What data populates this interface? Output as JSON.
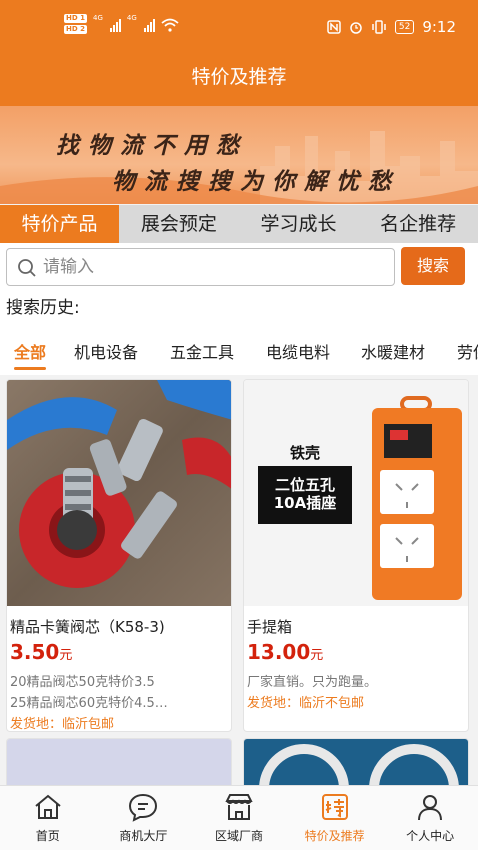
{
  "status_bar": {
    "time": "9:12",
    "hd1": "HD 1",
    "hd2": "HD 2",
    "net1": "4G",
    "net2": "4G",
    "battery": "52"
  },
  "header": {
    "title": "特价及推荐"
  },
  "banner": {
    "line1": "找物流不用愁",
    "line2": "物流搜搜为你解忧愁"
  },
  "tabs": [
    {
      "label": "特价产品",
      "active": true
    },
    {
      "label": "展会预定"
    },
    {
      "label": "学习成长"
    },
    {
      "label": "名企推荐"
    }
  ],
  "search": {
    "placeholder": "请输入",
    "button_label": "搜索"
  },
  "history_label": "搜索历史:",
  "categories": [
    {
      "label": "全部",
      "active": true
    },
    {
      "label": "机电设备"
    },
    {
      "label": "五金工具"
    },
    {
      "label": "电缆电料"
    },
    {
      "label": "水暖建材"
    },
    {
      "label": "劳保"
    }
  ],
  "products": [
    {
      "title": "精品卡簧阀芯（K58-3)",
      "price": "3.50",
      "unit": "元",
      "desc1": "20精品阀芯50克特价3.5",
      "desc2": "25精品阀芯60克特价4.5…",
      "ship": "发货地：临沂包邮"
    },
    {
      "title": "手提箱",
      "price": "13.00",
      "unit": "元",
      "desc1": "厂家直销。只为跑量。",
      "ship": "发货地：临沂不包邮",
      "image_text_top": "铁壳",
      "image_text_box1": "二位五孔",
      "image_text_box2": "10A插座"
    }
  ],
  "bottom_nav": [
    {
      "label": "首页",
      "icon": "home-icon"
    },
    {
      "label": "商机大厅",
      "icon": "chat-icon"
    },
    {
      "label": "区域厂商",
      "icon": "store-icon"
    },
    {
      "label": "特价及推荐",
      "icon": "special-icon",
      "active": true
    },
    {
      "label": "个人中心",
      "icon": "user-icon"
    }
  ],
  "colors": {
    "accent": "#ec7b1f",
    "price": "#d3220c",
    "tab_bg": "#d9d9d9"
  }
}
